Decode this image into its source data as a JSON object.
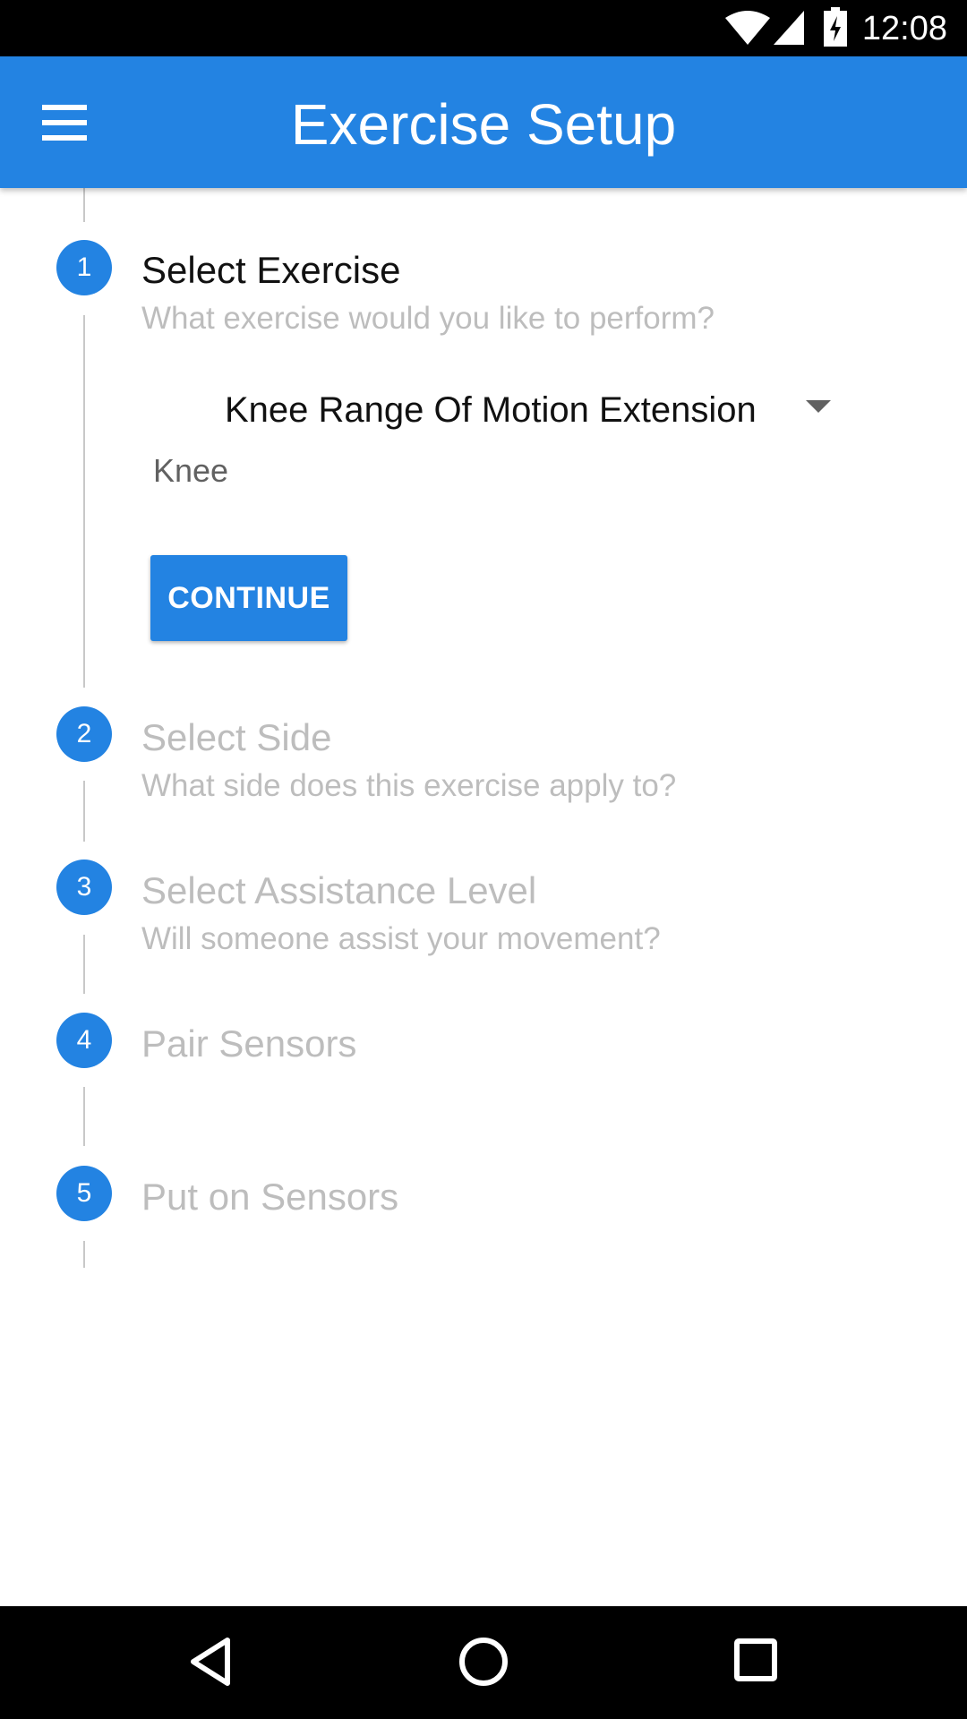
{
  "status_bar": {
    "time": "12:08"
  },
  "app_bar": {
    "title": "Exercise Setup",
    "menu_icon": "hamburger-menu-icon",
    "color": "#2383e2"
  },
  "stepper": {
    "steps": [
      {
        "number": "1",
        "title": "Select Exercise",
        "subtitle": "What exercise would you like to perform?",
        "active": true
      },
      {
        "number": "2",
        "title": "Select Side",
        "subtitle": "What side does this exercise apply to?",
        "active": false
      },
      {
        "number": "3",
        "title": "Select Assistance Level",
        "subtitle": "Will someone assist your movement?",
        "active": false
      },
      {
        "number": "4",
        "title": "Pair Sensors",
        "subtitle": "",
        "active": false
      },
      {
        "number": "5",
        "title": "Put on Sensors",
        "subtitle": "",
        "active": false
      }
    ],
    "exercise_select": {
      "selected": "Knee Range Of Motion Extension"
    },
    "body_part": "Knee",
    "continue_label": "CONTINUE"
  },
  "nav_bar": {
    "back_icon": "back-triangle-icon",
    "home_icon": "home-circle-icon",
    "recents_icon": "recents-square-icon"
  }
}
